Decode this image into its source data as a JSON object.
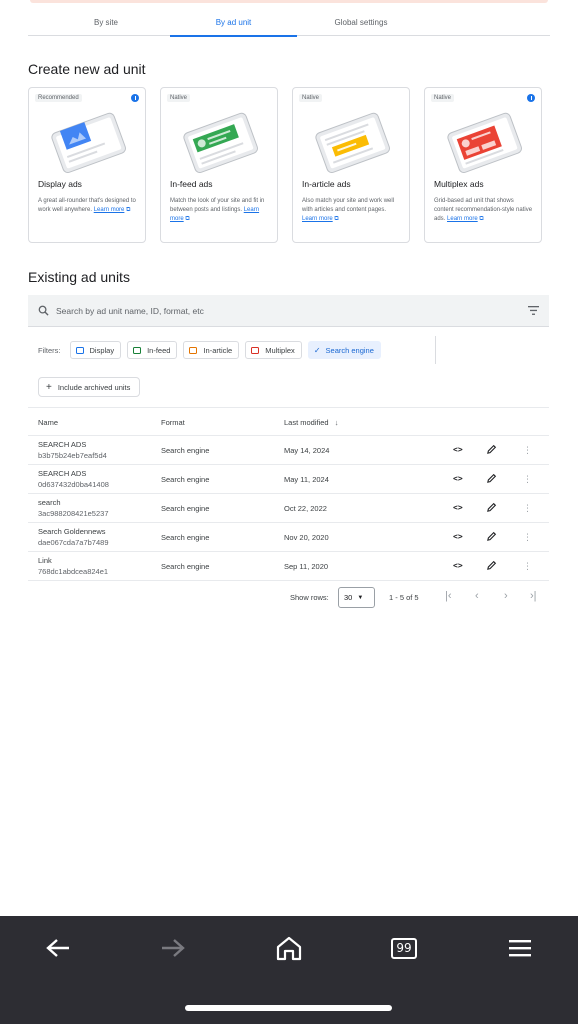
{
  "tabs": [
    {
      "label": "By site"
    },
    {
      "label": "By ad unit"
    },
    {
      "label": "Global settings"
    }
  ],
  "create_section": {
    "title": "Create new ad unit",
    "cards": [
      {
        "tag": "Recommended",
        "title": "Display ads",
        "desc": "A great all-rounder that's designed to work well anywhere.",
        "link": "Learn more",
        "accent": "#4285f4"
      },
      {
        "tag": "Native",
        "title": "In-feed ads",
        "desc": "Match the look of your site and fit in between posts and listings.",
        "link": "Learn more",
        "accent": "#34a853"
      },
      {
        "tag": "Native",
        "title": "In-article ads",
        "desc": "Also match your site and work well with articles and content pages.",
        "link": "Learn more",
        "accent": "#fbbc04"
      },
      {
        "tag": "Native",
        "title": "Multiplex ads",
        "desc": "Grid-based ad unit that shows content recommendation-style native ads.",
        "link": "Learn more",
        "accent": "#ea4335"
      }
    ]
  },
  "existing_section": {
    "title": "Existing ad units",
    "search_placeholder": "Search by ad unit name, ID, format, etc",
    "filters_label": "Filters:",
    "filters": [
      {
        "label": "Display",
        "color": "#1a73e8",
        "selected": false
      },
      {
        "label": "In-feed",
        "color": "#188038",
        "selected": false
      },
      {
        "label": "In-article",
        "color": "#e37400",
        "selected": false
      },
      {
        "label": "Multiplex",
        "color": "#d93025",
        "selected": false
      },
      {
        "label": "Search engine",
        "selected": true
      }
    ],
    "archived_label": "Include archived units",
    "columns": {
      "name": "Name",
      "format": "Format",
      "modified": "Last modified"
    },
    "rows": [
      {
        "name": "SEARCH ADS",
        "id": "b3b75b24eb7eaf5d4",
        "format": "Search engine",
        "date": "May 14, 2024"
      },
      {
        "name": "SEARCH ADS",
        "id": "0d637432d0ba41408",
        "format": "Search engine",
        "date": "May 11, 2024"
      },
      {
        "name": "search",
        "id": "3ac988208421e5237",
        "format": "Search engine",
        "date": "Oct 22, 2022"
      },
      {
        "name": "Search Goldennews",
        "id": "dae067cda7a7b7489",
        "format": "Search engine",
        "date": "Nov 20, 2020"
      },
      {
        "name": "Link",
        "id": "768dc1abdcea824e1",
        "format": "Search engine",
        "date": "Sep 11, 2020"
      }
    ],
    "pagination": {
      "rows_label": "Show rows:",
      "rows_value": "30",
      "range": "1 - 5 of 5"
    }
  },
  "browser_nav": {
    "tab_count": "99"
  },
  "colors": {
    "accent": "#1a73e8",
    "bottom_bar": "#2d2d33"
  }
}
